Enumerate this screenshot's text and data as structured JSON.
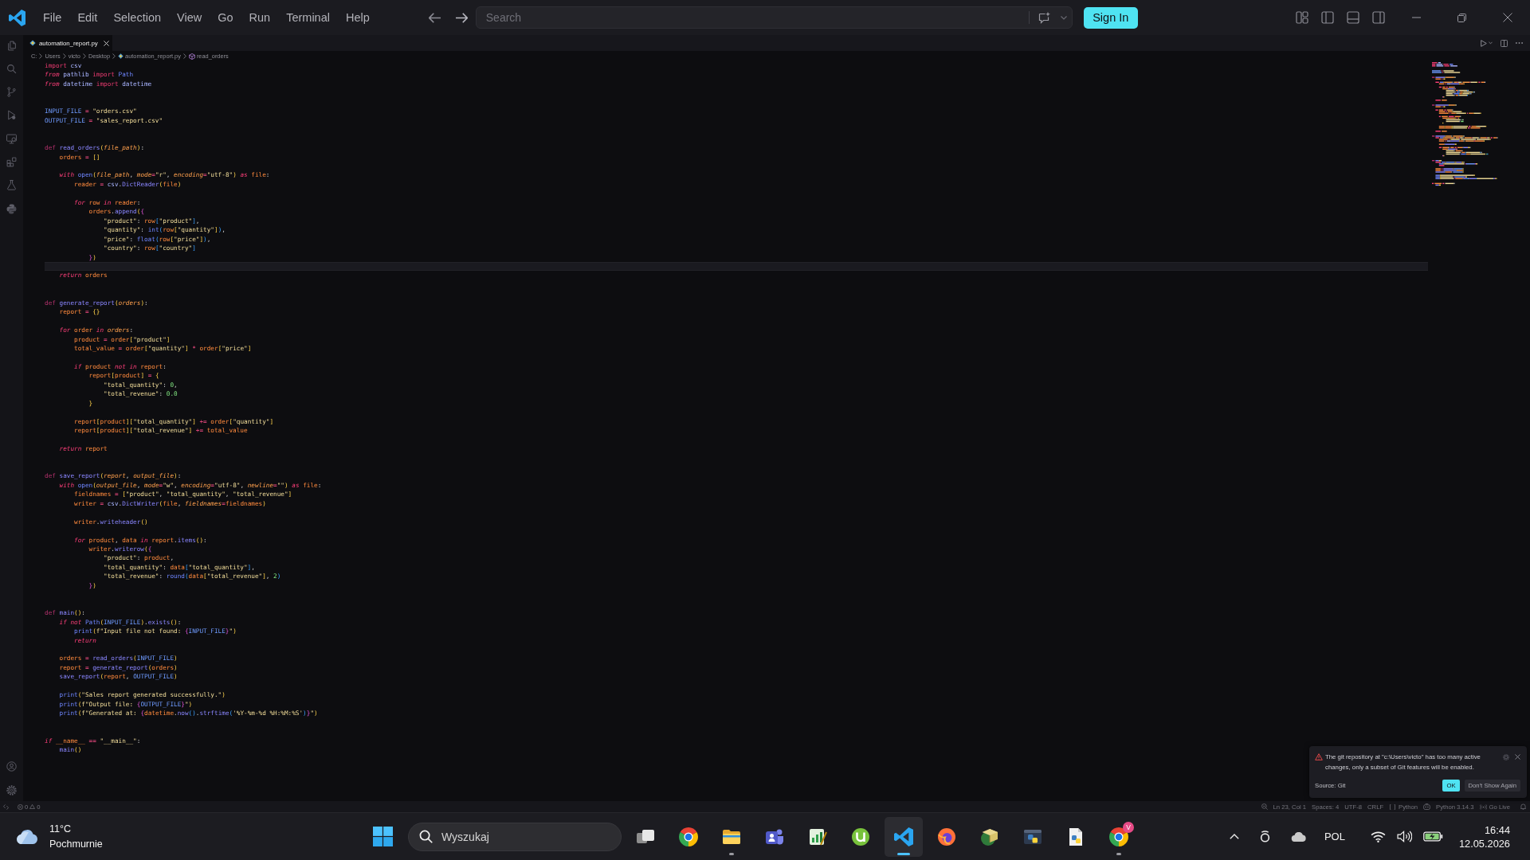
{
  "title_bar": {
    "menu": [
      "File",
      "Edit",
      "Selection",
      "View",
      "Go",
      "Run",
      "Terminal",
      "Help"
    ],
    "search": {
      "placeholder": "Search"
    },
    "sign_in": "Sign In"
  },
  "editor": {
    "tabs": [
      {
        "label": "automation_report.py",
        "selected": true
      }
    ],
    "breadcrumb": [
      {
        "kind": "folder",
        "text": "C:"
      },
      {
        "kind": "folder",
        "text": "Users"
      },
      {
        "kind": "folder",
        "text": "victo"
      },
      {
        "kind": "folder",
        "text": "Desktop"
      },
      {
        "kind": "file",
        "text": "automation_report.py"
      },
      {
        "kind": "symbol",
        "text": "read_orders"
      }
    ],
    "lines": [
      {
        "kind": "code",
        "tokens": [
          {
            "kind": "import",
            "text": "import"
          },
          {
            "kind": "module",
            "text": " csv"
          }
        ]
      },
      {
        "kind": "code",
        "tokens": [
          {
            "kind": "control",
            "text": "from"
          },
          {
            "kind": "module",
            "text": " pathlib "
          },
          {
            "kind": "import",
            "text": "import"
          },
          {
            "kind": "builtin",
            "text": " Path"
          }
        ]
      },
      {
        "kind": "code",
        "tokens": [
          {
            "kind": "control",
            "text": "from"
          },
          {
            "kind": "module",
            "text": " datetime "
          },
          {
            "kind": "import",
            "text": "import"
          },
          {
            "kind": "module",
            "text": " datetime"
          }
        ]
      },
      {
        "kind": "blank"
      },
      {
        "kind": "blank"
      },
      {
        "kind": "code",
        "tokens": [
          {
            "kind": "const",
            "text": "INPUT_FILE"
          },
          {
            "kind": "op",
            "text": " = "
          },
          {
            "kind": "str",
            "text": "\"orders.csv\""
          }
        ]
      },
      {
        "kind": "code",
        "tokens": [
          {
            "kind": "const",
            "text": "OUTPUT_FILE"
          },
          {
            "kind": "op",
            "text": " = "
          },
          {
            "kind": "str",
            "text": "\"sales_report.csv\""
          }
        ]
      },
      {
        "kind": "blank"
      },
      {
        "kind": "blank"
      },
      {
        "kind": "code",
        "tokens": [
          {
            "kind": "def",
            "text": "def"
          },
          {
            "kind": "func",
            "text": " read_orders"
          },
          {
            "kind": "brace",
            "text": "("
          },
          {
            "kind": "param",
            "text": "file_path"
          },
          {
            "kind": "brace",
            "text": ")"
          },
          {
            "kind": "plain",
            "text": ":"
          }
        ]
      },
      {
        "kind": "code",
        "tokens": [
          {
            "kind": "var",
            "text": "    orders"
          },
          {
            "kind": "op",
            "text": " = "
          },
          {
            "kind": "brace",
            "text": "[]"
          }
        ]
      },
      {
        "kind": "blank"
      },
      {
        "kind": "code",
        "tokens": [
          {
            "kind": "control",
            "text": "    with"
          },
          {
            "kind": "builtin",
            "text": " open"
          },
          {
            "kind": "brace",
            "text": "("
          },
          {
            "kind": "param",
            "text": "file_path"
          },
          {
            "kind": "plain",
            "text": ", "
          },
          {
            "kind": "param",
            "text": "mode"
          },
          {
            "kind": "op",
            "text": "="
          },
          {
            "kind": "str",
            "text": "\"r\""
          },
          {
            "kind": "plain",
            "text": ", "
          },
          {
            "kind": "param",
            "text": "encoding"
          },
          {
            "kind": "op",
            "text": "="
          },
          {
            "kind": "str",
            "text": "\"utf-8\""
          },
          {
            "kind": "brace",
            "text": ")"
          },
          {
            "kind": "control",
            "text": " as"
          },
          {
            "kind": "var",
            "text": " file"
          },
          {
            "kind": "plain",
            "text": ":"
          }
        ]
      },
      {
        "kind": "code",
        "tokens": [
          {
            "kind": "var",
            "text": "        reader"
          },
          {
            "kind": "op",
            "text": " = "
          },
          {
            "kind": "module",
            "text": "csv"
          },
          {
            "kind": "plain",
            "text": "."
          },
          {
            "kind": "func",
            "text": "DictReader"
          },
          {
            "kind": "brace",
            "text": "("
          },
          {
            "kind": "var",
            "text": "file"
          },
          {
            "kind": "brace",
            "text": ")"
          }
        ]
      },
      {
        "kind": "blank"
      },
      {
        "kind": "code",
        "tokens": [
          {
            "kind": "control",
            "text": "        for"
          },
          {
            "kind": "var",
            "text": " row"
          },
          {
            "kind": "control",
            "text": " in"
          },
          {
            "kind": "var",
            "text": " reader"
          },
          {
            "kind": "plain",
            "text": ":"
          }
        ]
      },
      {
        "kind": "code",
        "tokens": [
          {
            "kind": "var",
            "text": "            orders"
          },
          {
            "kind": "plain",
            "text": "."
          },
          {
            "kind": "func",
            "text": "append"
          },
          {
            "kind": "brace",
            "text": "("
          },
          {
            "kind": "brace2",
            "text": "{"
          }
        ]
      },
      {
        "kind": "code",
        "tokens": [
          {
            "kind": "str",
            "text": "                \"product\""
          },
          {
            "kind": "plain",
            "text": ": "
          },
          {
            "kind": "var",
            "text": "row"
          },
          {
            "kind": "brace3",
            "text": "["
          },
          {
            "kind": "str",
            "text": "\"product\""
          },
          {
            "kind": "brace3",
            "text": "]"
          },
          {
            "kind": "plain",
            "text": ","
          }
        ]
      },
      {
        "kind": "code",
        "tokens": [
          {
            "kind": "str",
            "text": "                \"quantity\""
          },
          {
            "kind": "plain",
            "text": ": "
          },
          {
            "kind": "builtin",
            "text": "int"
          },
          {
            "kind": "brace3",
            "text": "("
          },
          {
            "kind": "var",
            "text": "row"
          },
          {
            "kind": "brace",
            "text": "["
          },
          {
            "kind": "str",
            "text": "\"quantity\""
          },
          {
            "kind": "brace",
            "text": "]"
          },
          {
            "kind": "brace3",
            "text": ")"
          },
          {
            "kind": "plain",
            "text": ","
          }
        ]
      },
      {
        "kind": "code",
        "tokens": [
          {
            "kind": "str",
            "text": "                \"price\""
          },
          {
            "kind": "plain",
            "text": ": "
          },
          {
            "kind": "builtin",
            "text": "float"
          },
          {
            "kind": "brace3",
            "text": "("
          },
          {
            "kind": "var",
            "text": "row"
          },
          {
            "kind": "brace",
            "text": "["
          },
          {
            "kind": "str",
            "text": "\"price\""
          },
          {
            "kind": "brace",
            "text": "]"
          },
          {
            "kind": "brace3",
            "text": ")"
          },
          {
            "kind": "plain",
            "text": ","
          }
        ]
      },
      {
        "kind": "code",
        "tokens": [
          {
            "kind": "str",
            "text": "                \"country\""
          },
          {
            "kind": "plain",
            "text": ": "
          },
          {
            "kind": "var",
            "text": "row"
          },
          {
            "kind": "brace3",
            "text": "["
          },
          {
            "kind": "str",
            "text": "\"country\""
          },
          {
            "kind": "brace3",
            "text": "]"
          }
        ]
      },
      {
        "kind": "code",
        "tokens": [
          {
            "kind": "brace2",
            "text": "            }"
          },
          {
            "kind": "brace",
            "text": ")"
          }
        ]
      },
      {
        "kind": "current"
      },
      {
        "kind": "code",
        "tokens": [
          {
            "kind": "control",
            "text": "    return"
          },
          {
            "kind": "var",
            "text": " orders"
          }
        ]
      },
      {
        "kind": "blank"
      },
      {
        "kind": "blank"
      },
      {
        "kind": "code",
        "tokens": [
          {
            "kind": "def",
            "text": "def"
          },
          {
            "kind": "func",
            "text": " generate_report"
          },
          {
            "kind": "brace",
            "text": "("
          },
          {
            "kind": "param",
            "text": "orders"
          },
          {
            "kind": "brace",
            "text": ")"
          },
          {
            "kind": "plain",
            "text": ":"
          }
        ]
      },
      {
        "kind": "code",
        "tokens": [
          {
            "kind": "var",
            "text": "    report"
          },
          {
            "kind": "op",
            "text": " = "
          },
          {
            "kind": "brace",
            "text": "{}"
          }
        ]
      },
      {
        "kind": "blank"
      },
      {
        "kind": "code",
        "tokens": [
          {
            "kind": "control",
            "text": "    for"
          },
          {
            "kind": "var",
            "text": " order"
          },
          {
            "kind": "control",
            "text": " in"
          },
          {
            "kind": "param",
            "text": " orders"
          },
          {
            "kind": "plain",
            "text": ":"
          }
        ]
      },
      {
        "kind": "code",
        "tokens": [
          {
            "kind": "var",
            "text": "        product"
          },
          {
            "kind": "op",
            "text": " = "
          },
          {
            "kind": "var",
            "text": "order"
          },
          {
            "kind": "brace",
            "text": "["
          },
          {
            "kind": "str",
            "text": "\"product\""
          },
          {
            "kind": "brace",
            "text": "]"
          }
        ]
      },
      {
        "kind": "code",
        "tokens": [
          {
            "kind": "var",
            "text": "        total_value"
          },
          {
            "kind": "op",
            "text": " = "
          },
          {
            "kind": "var",
            "text": "order"
          },
          {
            "kind": "brace",
            "text": "["
          },
          {
            "kind": "str",
            "text": "\"quantity\""
          },
          {
            "kind": "brace",
            "text": "]"
          },
          {
            "kind": "op",
            "text": " * "
          },
          {
            "kind": "var",
            "text": "order"
          },
          {
            "kind": "brace",
            "text": "["
          },
          {
            "kind": "str",
            "text": "\"price\""
          },
          {
            "kind": "brace",
            "text": "]"
          }
        ]
      },
      {
        "kind": "blank"
      },
      {
        "kind": "code",
        "tokens": [
          {
            "kind": "control",
            "text": "        if"
          },
          {
            "kind": "var",
            "text": " product"
          },
          {
            "kind": "control",
            "text": " not in"
          },
          {
            "kind": "var",
            "text": " report"
          },
          {
            "kind": "plain",
            "text": ":"
          }
        ]
      },
      {
        "kind": "code",
        "tokens": [
          {
            "kind": "var",
            "text": "            report"
          },
          {
            "kind": "brace",
            "text": "["
          },
          {
            "kind": "var",
            "text": "product"
          },
          {
            "kind": "brace",
            "text": "]"
          },
          {
            "kind": "op",
            "text": " = "
          },
          {
            "kind": "brace",
            "text": "{"
          }
        ]
      },
      {
        "kind": "code",
        "tokens": [
          {
            "kind": "str",
            "text": "                \"total_quantity\""
          },
          {
            "kind": "plain",
            "text": ": "
          },
          {
            "kind": "num",
            "text": "0"
          },
          {
            "kind": "plain",
            "text": ","
          }
        ]
      },
      {
        "kind": "code",
        "tokens": [
          {
            "kind": "str",
            "text": "                \"total_revenue\""
          },
          {
            "kind": "plain",
            "text": ": "
          },
          {
            "kind": "num",
            "text": "0.0"
          }
        ]
      },
      {
        "kind": "code",
        "tokens": [
          {
            "kind": "brace",
            "text": "            }"
          }
        ]
      },
      {
        "kind": "blank"
      },
      {
        "kind": "code",
        "tokens": [
          {
            "kind": "var",
            "text": "        report"
          },
          {
            "kind": "brace",
            "text": "["
          },
          {
            "kind": "var",
            "text": "product"
          },
          {
            "kind": "brace",
            "text": "]["
          },
          {
            "kind": "str",
            "text": "\"total_quantity\""
          },
          {
            "kind": "brace",
            "text": "]"
          },
          {
            "kind": "op",
            "text": " += "
          },
          {
            "kind": "var",
            "text": "order"
          },
          {
            "kind": "brace",
            "text": "["
          },
          {
            "kind": "str",
            "text": "\"quantity\""
          },
          {
            "kind": "brace",
            "text": "]"
          }
        ]
      },
      {
        "kind": "code",
        "tokens": [
          {
            "kind": "var",
            "text": "        report"
          },
          {
            "kind": "brace",
            "text": "["
          },
          {
            "kind": "var",
            "text": "product"
          },
          {
            "kind": "brace",
            "text": "]["
          },
          {
            "kind": "str",
            "text": "\"total_revenue\""
          },
          {
            "kind": "brace",
            "text": "]"
          },
          {
            "kind": "op",
            "text": " += "
          },
          {
            "kind": "var",
            "text": "total_value"
          }
        ]
      },
      {
        "kind": "blank"
      },
      {
        "kind": "code",
        "tokens": [
          {
            "kind": "control",
            "text": "    return"
          },
          {
            "kind": "var",
            "text": " report"
          }
        ]
      },
      {
        "kind": "blank"
      },
      {
        "kind": "blank"
      },
      {
        "kind": "code",
        "tokens": [
          {
            "kind": "def",
            "text": "def"
          },
          {
            "kind": "func",
            "text": " save_report"
          },
          {
            "kind": "brace",
            "text": "("
          },
          {
            "kind": "param",
            "text": "report"
          },
          {
            "kind": "plain",
            "text": ", "
          },
          {
            "kind": "param",
            "text": "output_file"
          },
          {
            "kind": "brace",
            "text": ")"
          },
          {
            "kind": "plain",
            "text": ":"
          }
        ]
      },
      {
        "kind": "code",
        "tokens": [
          {
            "kind": "control",
            "text": "    with"
          },
          {
            "kind": "builtin",
            "text": " open"
          },
          {
            "kind": "brace",
            "text": "("
          },
          {
            "kind": "param",
            "text": "output_file"
          },
          {
            "kind": "plain",
            "text": ", "
          },
          {
            "kind": "param",
            "text": "mode"
          },
          {
            "kind": "op",
            "text": "="
          },
          {
            "kind": "str",
            "text": "\"w\""
          },
          {
            "kind": "plain",
            "text": ", "
          },
          {
            "kind": "param",
            "text": "encoding"
          },
          {
            "kind": "op",
            "text": "="
          },
          {
            "kind": "str",
            "text": "\"utf-8\""
          },
          {
            "kind": "plain",
            "text": ", "
          },
          {
            "kind": "param",
            "text": "newline"
          },
          {
            "kind": "op",
            "text": "="
          },
          {
            "kind": "str",
            "text": "\"\""
          },
          {
            "kind": "brace",
            "text": ")"
          },
          {
            "kind": "control",
            "text": " as"
          },
          {
            "kind": "var",
            "text": " file"
          },
          {
            "kind": "plain",
            "text": ":"
          }
        ]
      },
      {
        "kind": "code",
        "tokens": [
          {
            "kind": "var",
            "text": "        fieldnames"
          },
          {
            "kind": "op",
            "text": " = "
          },
          {
            "kind": "brace",
            "text": "["
          },
          {
            "kind": "str",
            "text": "\"product\""
          },
          {
            "kind": "plain",
            "text": ", "
          },
          {
            "kind": "str",
            "text": "\"total_quantity\""
          },
          {
            "kind": "plain",
            "text": ", "
          },
          {
            "kind": "str",
            "text": "\"total_revenue\""
          },
          {
            "kind": "brace",
            "text": "]"
          }
        ]
      },
      {
        "kind": "code",
        "tokens": [
          {
            "kind": "var",
            "text": "        writer"
          },
          {
            "kind": "op",
            "text": " = "
          },
          {
            "kind": "module",
            "text": "csv"
          },
          {
            "kind": "plain",
            "text": "."
          },
          {
            "kind": "func",
            "text": "DictWriter"
          },
          {
            "kind": "brace",
            "text": "("
          },
          {
            "kind": "var",
            "text": "file"
          },
          {
            "kind": "plain",
            "text": ", "
          },
          {
            "kind": "param",
            "text": "fieldnames"
          },
          {
            "kind": "op",
            "text": "="
          },
          {
            "kind": "var",
            "text": "fieldnames"
          },
          {
            "kind": "brace",
            "text": ")"
          }
        ]
      },
      {
        "kind": "blank"
      },
      {
        "kind": "code",
        "tokens": [
          {
            "kind": "var",
            "text": "        writer"
          },
          {
            "kind": "plain",
            "text": "."
          },
          {
            "kind": "func",
            "text": "writeheader"
          },
          {
            "kind": "brace",
            "text": "()"
          }
        ]
      },
      {
        "kind": "blank"
      },
      {
        "kind": "code",
        "tokens": [
          {
            "kind": "control",
            "text": "        for"
          },
          {
            "kind": "var",
            "text": " product"
          },
          {
            "kind": "plain",
            "text": ", "
          },
          {
            "kind": "var",
            "text": "data"
          },
          {
            "kind": "control",
            "text": " in"
          },
          {
            "kind": "var",
            "text": " report"
          },
          {
            "kind": "plain",
            "text": "."
          },
          {
            "kind": "func",
            "text": "items"
          },
          {
            "kind": "brace",
            "text": "()"
          },
          {
            "kind": "plain",
            "text": ":"
          }
        ]
      },
      {
        "kind": "code",
        "tokens": [
          {
            "kind": "var",
            "text": "            writer"
          },
          {
            "kind": "plain",
            "text": "."
          },
          {
            "kind": "func",
            "text": "writerow"
          },
          {
            "kind": "brace",
            "text": "("
          },
          {
            "kind": "brace2",
            "text": "{"
          }
        ]
      },
      {
        "kind": "code",
        "tokens": [
          {
            "kind": "str",
            "text": "                \"product\""
          },
          {
            "kind": "plain",
            "text": ": "
          },
          {
            "kind": "var",
            "text": "product"
          },
          {
            "kind": "plain",
            "text": ","
          }
        ]
      },
      {
        "kind": "code",
        "tokens": [
          {
            "kind": "str",
            "text": "                \"total_quantity\""
          },
          {
            "kind": "plain",
            "text": ": "
          },
          {
            "kind": "var",
            "text": "data"
          },
          {
            "kind": "brace3",
            "text": "["
          },
          {
            "kind": "str",
            "text": "\"total_quantity\""
          },
          {
            "kind": "brace3",
            "text": "]"
          },
          {
            "kind": "plain",
            "text": ","
          }
        ]
      },
      {
        "kind": "code",
        "tokens": [
          {
            "kind": "str",
            "text": "                \"total_revenue\""
          },
          {
            "kind": "plain",
            "text": ": "
          },
          {
            "kind": "builtin",
            "text": "round"
          },
          {
            "kind": "brace3",
            "text": "("
          },
          {
            "kind": "var",
            "text": "data"
          },
          {
            "kind": "brace",
            "text": "["
          },
          {
            "kind": "str",
            "text": "\"total_revenue\""
          },
          {
            "kind": "brace",
            "text": "]"
          },
          {
            "kind": "plain",
            "text": ", "
          },
          {
            "kind": "num",
            "text": "2"
          },
          {
            "kind": "brace3",
            "text": ")"
          }
        ]
      },
      {
        "kind": "code",
        "tokens": [
          {
            "kind": "brace2",
            "text": "            }"
          },
          {
            "kind": "brace",
            "text": ")"
          }
        ]
      },
      {
        "kind": "blank"
      },
      {
        "kind": "blank"
      },
      {
        "kind": "code",
        "tokens": [
          {
            "kind": "def",
            "text": "def"
          },
          {
            "kind": "func",
            "text": " main"
          },
          {
            "kind": "brace",
            "text": "()"
          },
          {
            "kind": "plain",
            "text": ":"
          }
        ]
      },
      {
        "kind": "code",
        "tokens": [
          {
            "kind": "control",
            "text": "    if not"
          },
          {
            "kind": "builtin",
            "text": " Path"
          },
          {
            "kind": "brace",
            "text": "("
          },
          {
            "kind": "const",
            "text": "INPUT_FILE"
          },
          {
            "kind": "brace",
            "text": ")"
          },
          {
            "kind": "plain",
            "text": "."
          },
          {
            "kind": "func",
            "text": "exists"
          },
          {
            "kind": "brace",
            "text": "()"
          },
          {
            "kind": "plain",
            "text": ":"
          }
        ]
      },
      {
        "kind": "code",
        "tokens": [
          {
            "kind": "builtin",
            "text": "        print"
          },
          {
            "kind": "brace",
            "text": "("
          },
          {
            "kind": "str",
            "text": "f\"Input file not found: "
          },
          {
            "kind": "brace2",
            "text": "{"
          },
          {
            "kind": "const",
            "text": "INPUT_FILE"
          },
          {
            "kind": "brace2",
            "text": "}"
          },
          {
            "kind": "str",
            "text": "\""
          },
          {
            "kind": "brace",
            "text": ")"
          }
        ]
      },
      {
        "kind": "code",
        "tokens": [
          {
            "kind": "control",
            "text": "        return"
          }
        ]
      },
      {
        "kind": "blank"
      },
      {
        "kind": "code",
        "tokens": [
          {
            "kind": "var",
            "text": "    orders"
          },
          {
            "kind": "op",
            "text": " = "
          },
          {
            "kind": "func",
            "text": "read_orders"
          },
          {
            "kind": "brace",
            "text": "("
          },
          {
            "kind": "const",
            "text": "INPUT_FILE"
          },
          {
            "kind": "brace",
            "text": ")"
          }
        ]
      },
      {
        "kind": "code",
        "tokens": [
          {
            "kind": "var",
            "text": "    report"
          },
          {
            "kind": "op",
            "text": " = "
          },
          {
            "kind": "func",
            "text": "generate_report"
          },
          {
            "kind": "brace",
            "text": "("
          },
          {
            "kind": "var",
            "text": "orders"
          },
          {
            "kind": "brace",
            "text": ")"
          }
        ]
      },
      {
        "kind": "code",
        "tokens": [
          {
            "kind": "func",
            "text": "    save_report"
          },
          {
            "kind": "brace",
            "text": "("
          },
          {
            "kind": "var",
            "text": "report"
          },
          {
            "kind": "plain",
            "text": ", "
          },
          {
            "kind": "const",
            "text": "OUTPUT_FILE"
          },
          {
            "kind": "brace",
            "text": ")"
          }
        ]
      },
      {
        "kind": "blank"
      },
      {
        "kind": "code",
        "tokens": [
          {
            "kind": "builtin",
            "text": "    print"
          },
          {
            "kind": "brace",
            "text": "("
          },
          {
            "kind": "str",
            "text": "\"Sales report generated successfully.\""
          },
          {
            "kind": "brace",
            "text": ")"
          }
        ]
      },
      {
        "kind": "code",
        "tokens": [
          {
            "kind": "builtin",
            "text": "    print"
          },
          {
            "kind": "brace",
            "text": "("
          },
          {
            "kind": "str",
            "text": "f\"Output file: "
          },
          {
            "kind": "brace2",
            "text": "{"
          },
          {
            "kind": "const",
            "text": "OUTPUT_FILE"
          },
          {
            "kind": "brace2",
            "text": "}"
          },
          {
            "kind": "str",
            "text": "\""
          },
          {
            "kind": "brace",
            "text": ")"
          }
        ]
      },
      {
        "kind": "code",
        "tokens": [
          {
            "kind": "builtin",
            "text": "    print"
          },
          {
            "kind": "brace",
            "text": "("
          },
          {
            "kind": "str",
            "text": "f\"Generated at: "
          },
          {
            "kind": "brace2",
            "text": "{"
          },
          {
            "kind": "var",
            "text": "datetime"
          },
          {
            "kind": "plain",
            "text": "."
          },
          {
            "kind": "func",
            "text": "now"
          },
          {
            "kind": "brace3",
            "text": "()"
          },
          {
            "kind": "plain",
            "text": "."
          },
          {
            "kind": "func",
            "text": "strftime"
          },
          {
            "kind": "brace3",
            "text": "("
          },
          {
            "kind": "str",
            "text": "'%Y-%m-%d %H:%M:%S'"
          },
          {
            "kind": "brace3",
            "text": ")"
          },
          {
            "kind": "brace2",
            "text": "}"
          },
          {
            "kind": "str",
            "text": "\""
          },
          {
            "kind": "brace",
            "text": ")"
          }
        ]
      },
      {
        "kind": "blank"
      },
      {
        "kind": "blank"
      },
      {
        "kind": "code",
        "tokens": [
          {
            "kind": "control",
            "text": "if"
          },
          {
            "kind": "var",
            "text": " __name__"
          },
          {
            "kind": "op",
            "text": " == "
          },
          {
            "kind": "str",
            "text": "\"__main__\""
          },
          {
            "kind": "plain",
            "text": ":"
          }
        ]
      },
      {
        "kind": "code",
        "tokens": [
          {
            "kind": "func",
            "text": "    main"
          },
          {
            "kind": "brace",
            "text": "()"
          }
        ]
      }
    ]
  },
  "notification": {
    "kind": "warning",
    "message": "The git repository at \"c:\\Users\\victo\" has too many active changes, only a subset of Git features will be enabled.",
    "source": "Source: Git",
    "buttons": [
      {
        "label": "OK",
        "primary": true
      },
      {
        "label": "Don't Show Again",
        "primary": false
      }
    ]
  },
  "status_bar": {
    "problems": {
      "errors": "0",
      "warnings": "0"
    },
    "items": [
      {
        "kind": "zoom"
      },
      {
        "kind": "text",
        "text": "Ln 23, Col 1"
      },
      {
        "kind": "text",
        "text": "Spaces: 4"
      },
      {
        "kind": "text",
        "text": "UTF-8"
      },
      {
        "kind": "text",
        "text": "CRLF"
      },
      {
        "kind": "language",
        "text": "Python"
      },
      {
        "kind": "copilot"
      },
      {
        "kind": "text",
        "text": "Python 3.14.3"
      },
      {
        "kind": "live",
        "text": "Go Live"
      },
      {
        "kind": "bell"
      }
    ]
  },
  "taskbar": {
    "weather": {
      "temperature": "11°C",
      "condition": "Pochmurnie"
    },
    "search": {
      "placeholder": "Wyszukaj"
    },
    "apps": [
      {
        "kind": "task-view",
        "running": false,
        "active": false
      },
      {
        "kind": "browser",
        "running": false,
        "active": false
      },
      {
        "kind": "files",
        "running": true,
        "active": false
      },
      {
        "kind": "people",
        "running": false,
        "active": false
      },
      {
        "kind": "chart",
        "running": false,
        "active": false
      },
      {
        "kind": "download",
        "running": false,
        "active": false
      },
      {
        "kind": "code",
        "running": true,
        "active": true
      },
      {
        "kind": "fox-browser",
        "running": false,
        "active": false
      },
      {
        "kind": "package",
        "running": false,
        "active": false
      },
      {
        "kind": "app-window",
        "running": false,
        "active": false
      },
      {
        "kind": "document",
        "running": false,
        "active": false
      },
      {
        "kind": "browser",
        "running": true,
        "active": false,
        "badge": "V"
      }
    ],
    "tray": {
      "language": "POL",
      "time": "16:44",
      "date": "12.05.2026"
    }
  }
}
